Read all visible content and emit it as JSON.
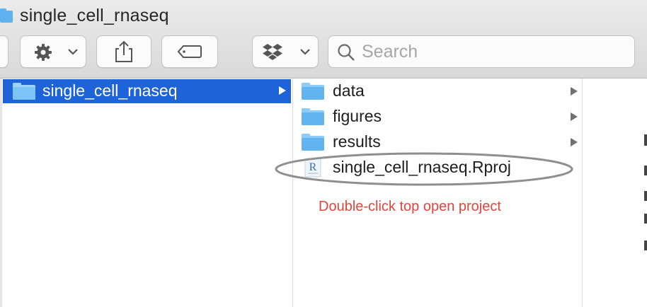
{
  "window": {
    "title": "single_cell_rnaseq"
  },
  "toolbar": {
    "action_menu_icon": "gear-icon",
    "share_icon": "share-icon",
    "tag_icon": "tag-icon",
    "dropbox_icon": "dropbox-icon",
    "search_placeholder": "Search"
  },
  "left_column": {
    "selected_item": {
      "label": "single_cell_rnaseq",
      "icon": "folder-icon"
    }
  },
  "middle_column": {
    "items": [
      {
        "label": "data",
        "icon": "folder-icon"
      },
      {
        "label": "figures",
        "icon": "folder-icon"
      },
      {
        "label": "results",
        "icon": "folder-icon"
      },
      {
        "label": "single_cell_rnaseq.Rproj",
        "icon": "rproj-file-icon"
      }
    ]
  },
  "annotation": {
    "text": "Double-click top open project",
    "color": "#e0463d"
  },
  "colors": {
    "selection": "#1f63d9",
    "folder": "#62b4ee"
  }
}
